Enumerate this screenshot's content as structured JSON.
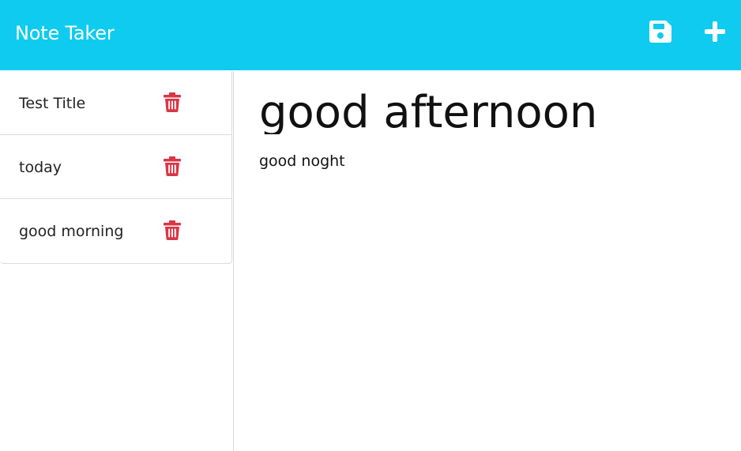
{
  "app": {
    "brand": "Note Taker"
  },
  "toolbar": {
    "save_icon": "floppy-disk-icon",
    "new_icon": "plus-icon"
  },
  "sidebar": {
    "notes": [
      {
        "title": "Test Title",
        "delete_icon": "trash-icon"
      },
      {
        "title": "today",
        "delete_icon": "trash-icon"
      },
      {
        "title": "good morning",
        "delete_icon": "trash-icon"
      }
    ]
  },
  "editor": {
    "title": "good afternoon",
    "body": "good noght"
  },
  "colors": {
    "header_bg": "#0ecbef",
    "delete_red": "#dc3545",
    "text": "#222222"
  }
}
